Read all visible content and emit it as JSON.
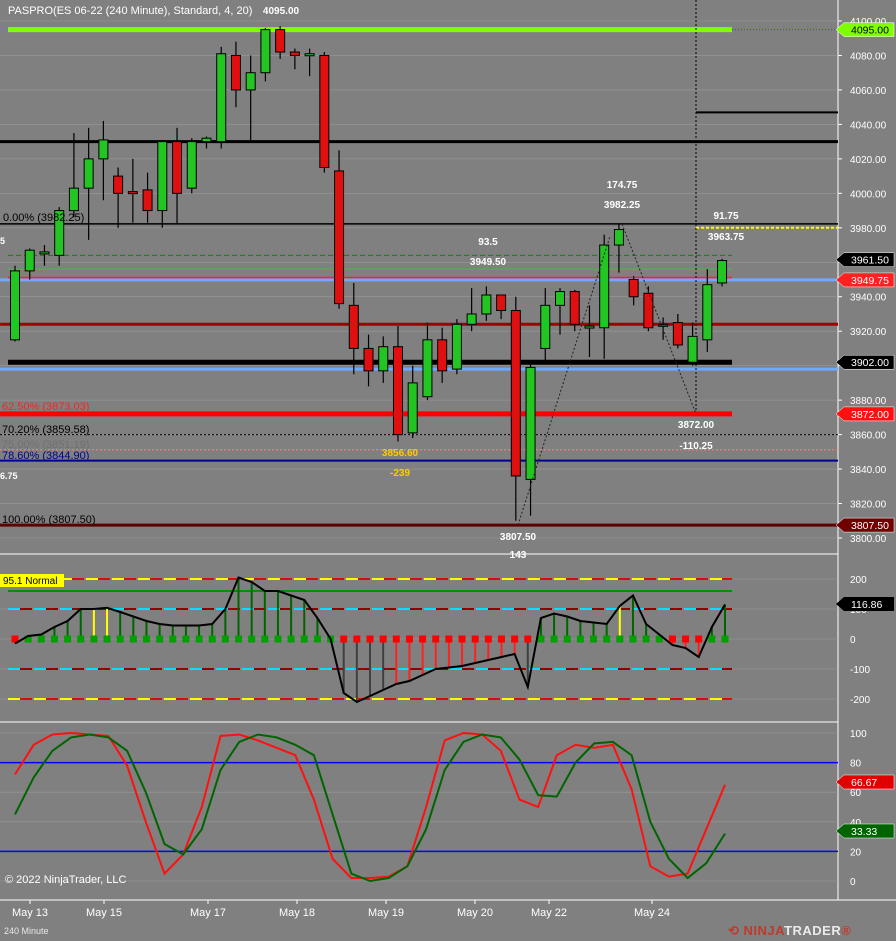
{
  "window": {
    "chart_title": "PASPRO(ES 06-22 (240 Minute), Standard, 4, 20)",
    "copyright": "© 2022 NinjaTrader, LLC",
    "timeframe_label": "240 Minute",
    "brand": {
      "prefix": "NINJA",
      "suffix": "TRADER",
      "registered": "®"
    }
  },
  "colors": {
    "background": "#808080",
    "grid": "#9a9a9a",
    "up_candle": "#22c522",
    "down_candle": "#e01010",
    "lime_line": "#80ff00",
    "level_red": "#ff0000",
    "level_blue": "#6fa8ff",
    "level_navy": "#000090",
    "stoch_fast": "#ff1010",
    "stoch_slow": "#006400",
    "stoch_level": "#0000ff"
  },
  "chart_data": [
    {
      "type": "candlestick",
      "panel": "price",
      "ylim": [
        3795,
        4106
      ],
      "y_ticks": [
        3800,
        3820,
        3840,
        3860,
        3880,
        3900,
        3920,
        3940,
        3960,
        3980,
        4000,
        4020,
        4040,
        4060,
        4080,
        4100
      ],
      "x_tick_labels": [
        "May 13",
        "May 15",
        "May 17",
        "May 18",
        "May 19",
        "May 20",
        "May 22",
        "May 24"
      ],
      "candles": [
        {
          "o": 3915,
          "h": 3958,
          "l": 3914,
          "c": 3955
        },
        {
          "o": 3955,
          "h": 3968,
          "l": 3950,
          "c": 3967
        },
        {
          "o": 3966,
          "h": 3970,
          "l": 3958,
          "c": 3966
        },
        {
          "o": 3964,
          "h": 3992,
          "l": 3958,
          "c": 3990
        },
        {
          "o": 3990,
          "h": 4035,
          "l": 3986,
          "c": 4003
        },
        {
          "o": 4003,
          "h": 4038,
          "l": 3973,
          "c": 4020
        },
        {
          "o": 4020,
          "h": 4042,
          "l": 3996,
          "c": 4031
        },
        {
          "o": 4010,
          "h": 4015,
          "l": 3980,
          "c": 4000
        },
        {
          "o": 4001,
          "h": 4020,
          "l": 3983,
          "c": 4000
        },
        {
          "o": 4002,
          "h": 4012,
          "l": 3983,
          "c": 3990
        },
        {
          "o": 3990,
          "h": 4031,
          "l": 3980,
          "c": 4030
        },
        {
          "o": 4030,
          "h": 4038,
          "l": 3982,
          "c": 4000
        },
        {
          "o": 4003,
          "h": 4032,
          "l": 4000,
          "c": 4030
        },
        {
          "o": 4030,
          "h": 4033,
          "l": 4026,
          "c": 4032
        },
        {
          "o": 4030,
          "h": 4085,
          "l": 4026,
          "c": 4081
        },
        {
          "o": 4080,
          "h": 4088,
          "l": 4050,
          "c": 4060
        },
        {
          "o": 4060,
          "h": 4080,
          "l": 4030,
          "c": 4070
        },
        {
          "o": 4070,
          "h": 4096,
          "l": 4065,
          "c": 4095
        },
        {
          "o": 4095,
          "h": 4097,
          "l": 4078,
          "c": 4082
        },
        {
          "o": 4082,
          "h": 4084,
          "l": 4072,
          "c": 4080
        },
        {
          "o": 4080,
          "h": 4084,
          "l": 4068,
          "c": 4081
        },
        {
          "o": 4080,
          "h": 4082,
          "l": 4012,
          "c": 4015
        },
        {
          "o": 4013,
          "h": 4025,
          "l": 3933,
          "c": 3936
        },
        {
          "o": 3935,
          "h": 3948,
          "l": 3895,
          "c": 3910
        },
        {
          "o": 3910,
          "h": 3918,
          "l": 3888,
          "c": 3897
        },
        {
          "o": 3897,
          "h": 3917,
          "l": 3890,
          "c": 3911
        },
        {
          "o": 3911,
          "h": 3923,
          "l": 3856,
          "c": 3860
        },
        {
          "o": 3861,
          "h": 3900,
          "l": 3858,
          "c": 3890
        },
        {
          "o": 3882,
          "h": 3925,
          "l": 3880,
          "c": 3915
        },
        {
          "o": 3915,
          "h": 3922,
          "l": 3890,
          "c": 3897
        },
        {
          "o": 3898,
          "h": 3927,
          "l": 3895,
          "c": 3924
        },
        {
          "o": 3924,
          "h": 3945,
          "l": 3920,
          "c": 3930
        },
        {
          "o": 3930,
          "h": 3946,
          "l": 3926,
          "c": 3941
        },
        {
          "o": 3941,
          "h": 3941,
          "l": 3927,
          "c": 3932
        },
        {
          "o": 3932,
          "h": 3940,
          "l": 3810,
          "c": 3836
        },
        {
          "o": 3834,
          "h": 3902,
          "l": 3813,
          "c": 3899
        },
        {
          "o": 3910,
          "h": 3945,
          "l": 3902,
          "c": 3935
        },
        {
          "o": 3935,
          "h": 3945,
          "l": 3918,
          "c": 3943
        },
        {
          "o": 3943,
          "h": 3944,
          "l": 3920,
          "c": 3924
        },
        {
          "o": 3922,
          "h": 3935,
          "l": 3905,
          "c": 3923
        },
        {
          "o": 3922,
          "h": 3976,
          "l": 3904,
          "c": 3970
        },
        {
          "o": 3970,
          "h": 3982,
          "l": 3954,
          "c": 3979
        },
        {
          "o": 3950,
          "h": 3952,
          "l": 3935,
          "c": 3940
        },
        {
          "o": 3942,
          "h": 3946,
          "l": 3920,
          "c": 3922
        },
        {
          "o": 3924,
          "h": 3928,
          "l": 3915,
          "c": 3923
        },
        {
          "o": 3925,
          "h": 3930,
          "l": 3910,
          "c": 3912
        },
        {
          "o": 3902,
          "h": 3925,
          "l": 3900,
          "c": 3917
        },
        {
          "o": 3915,
          "h": 3956,
          "l": 3908,
          "c": 3947
        },
        {
          "o": 3948,
          "h": 3962,
          "l": 3946,
          "c": 3961
        }
      ],
      "last_price": 3961.5
    },
    {
      "type": "line",
      "panel": "oscillator",
      "ylim": [
        -235,
        240
      ],
      "y_ticks": [
        200,
        100,
        0,
        -100,
        -200
      ],
      "bands": [
        {
          "value": 200,
          "style": "yellow-red-dash"
        },
        {
          "value": 160,
          "style": "green"
        },
        {
          "value": 100,
          "style": "cyan-darkred-dash"
        },
        {
          "value": -100,
          "style": "cyan-darkred-dash"
        },
        {
          "value": -200,
          "style": "yellow-red-dash"
        }
      ],
      "values": [
        -15,
        10,
        15,
        40,
        60,
        100,
        100,
        104,
        90,
        75,
        60,
        50,
        45,
        45,
        45,
        50,
        100,
        205,
        190,
        160,
        160,
        145,
        130,
        70,
        0,
        -180,
        -210,
        -190,
        -170,
        -150,
        -140,
        -120,
        -100,
        -95,
        -90,
        -80,
        -70,
        -60,
        -50,
        -160,
        70,
        85,
        75,
        60,
        55,
        50,
        110,
        145,
        50,
        15,
        -20,
        -30,
        -60,
        40,
        115
      ],
      "readout": "116.86",
      "status_label": "95.1 Normal"
    },
    {
      "type": "line",
      "panel": "stochastics",
      "ylim": [
        -10,
        110
      ],
      "y_ticks": [
        100,
        80,
        60,
        40,
        20,
        0
      ],
      "levels": [
        80,
        20
      ],
      "series": [
        {
          "values": [
            72,
            92,
            99,
            100,
            99,
            98,
            78,
            40,
            5,
            18,
            50,
            98,
            99,
            95,
            90,
            85,
            55,
            15,
            2,
            2,
            3,
            10,
            50,
            95,
            100,
            99,
            88,
            55,
            50,
            85,
            92,
            90,
            92,
            62,
            10,
            3,
            5,
            35,
            65
          ]
        },
        {
          "values": [
            45,
            70,
            88,
            97,
            99,
            97,
            88,
            60,
            25,
            18,
            35,
            75,
            94,
            99,
            97,
            92,
            85,
            45,
            5,
            0,
            2,
            10,
            35,
            75,
            94,
            99,
            97,
            82,
            58,
            57,
            80,
            93,
            94,
            85,
            40,
            15,
            2,
            12,
            32
          ]
        }
      ],
      "readouts": [
        "66.67",
        "33.33"
      ]
    }
  ],
  "price_axis": {
    "tick_labels": [
      "4100.00",
      "4080.00",
      "4060.00",
      "4040.00",
      "4020.00",
      "4000.00",
      "3980.00",
      "3960.00",
      "3940.00",
      "3920.00",
      "3900.00",
      "3880.00",
      "3860.00",
      "3840.00",
      "3820.00",
      "3800.00"
    ],
    "badges": [
      {
        "text": "4095.00",
        "bg": "#80ff00",
        "fg": "#000000",
        "value": 4095
      },
      {
        "text": "3961.50",
        "bg": "#000000",
        "fg": "#ffffff",
        "value": 3961.5
      },
      {
        "text": "3949.75",
        "bg": "#ff2020",
        "fg": "#ffffff",
        "value": 3949.75
      },
      {
        "text": "3902.00",
        "bg": "#000000",
        "fg": "#ffffff",
        "value": 3902
      },
      {
        "text": "3872.00",
        "bg": "#ff1010",
        "fg": "#ffffff",
        "value": 3872
      },
      {
        "text": "3807.50",
        "bg": "#700000",
        "fg": "#ffffff",
        "value": 3807.5
      }
    ]
  },
  "osc_axis": {
    "tick_labels": [
      "200",
      "100",
      "0",
      "-100",
      "-200"
    ],
    "badge": {
      "text": "116.86",
      "bg": "#000000",
      "fg": "#ffffff"
    }
  },
  "stoch_axis": {
    "tick_labels": [
      "100",
      "80",
      "60",
      "40",
      "20",
      "0"
    ],
    "badges": [
      {
        "text": "66.67",
        "bg": "#e00000",
        "fg": "#ffffff"
      },
      {
        "text": "33.33",
        "bg": "#006400",
        "fg": "#ffffff"
      }
    ]
  },
  "annotations": {
    "top_high": "4095.00",
    "fib_000": "0.00% (3982.25)",
    "fib_625": "62.50% (3873.03)",
    "fib_702": "70.20% (3859.58)",
    "fib_750": "75.00% (3851.19)",
    "fib_786": "78.60% (3844.90)",
    "fib_100": "100.00% (3807.50)",
    "left_edge_a": "5",
    "left_edge_b": "6.75",
    "mid_swing": "93.5",
    "mid_level": "3949.50",
    "swing_high_delta": "174.75",
    "swing_high": "3982.25",
    "right_delta": "91.75",
    "right_level": "3963.75",
    "swing_low_a": "3856.60",
    "swing_low_a_delta": "-239",
    "swing_low_b": "3807.50",
    "swing_low_b_delta": "143",
    "swing_low_c": "3872.00",
    "swing_low_c_delta": "-110.25"
  }
}
